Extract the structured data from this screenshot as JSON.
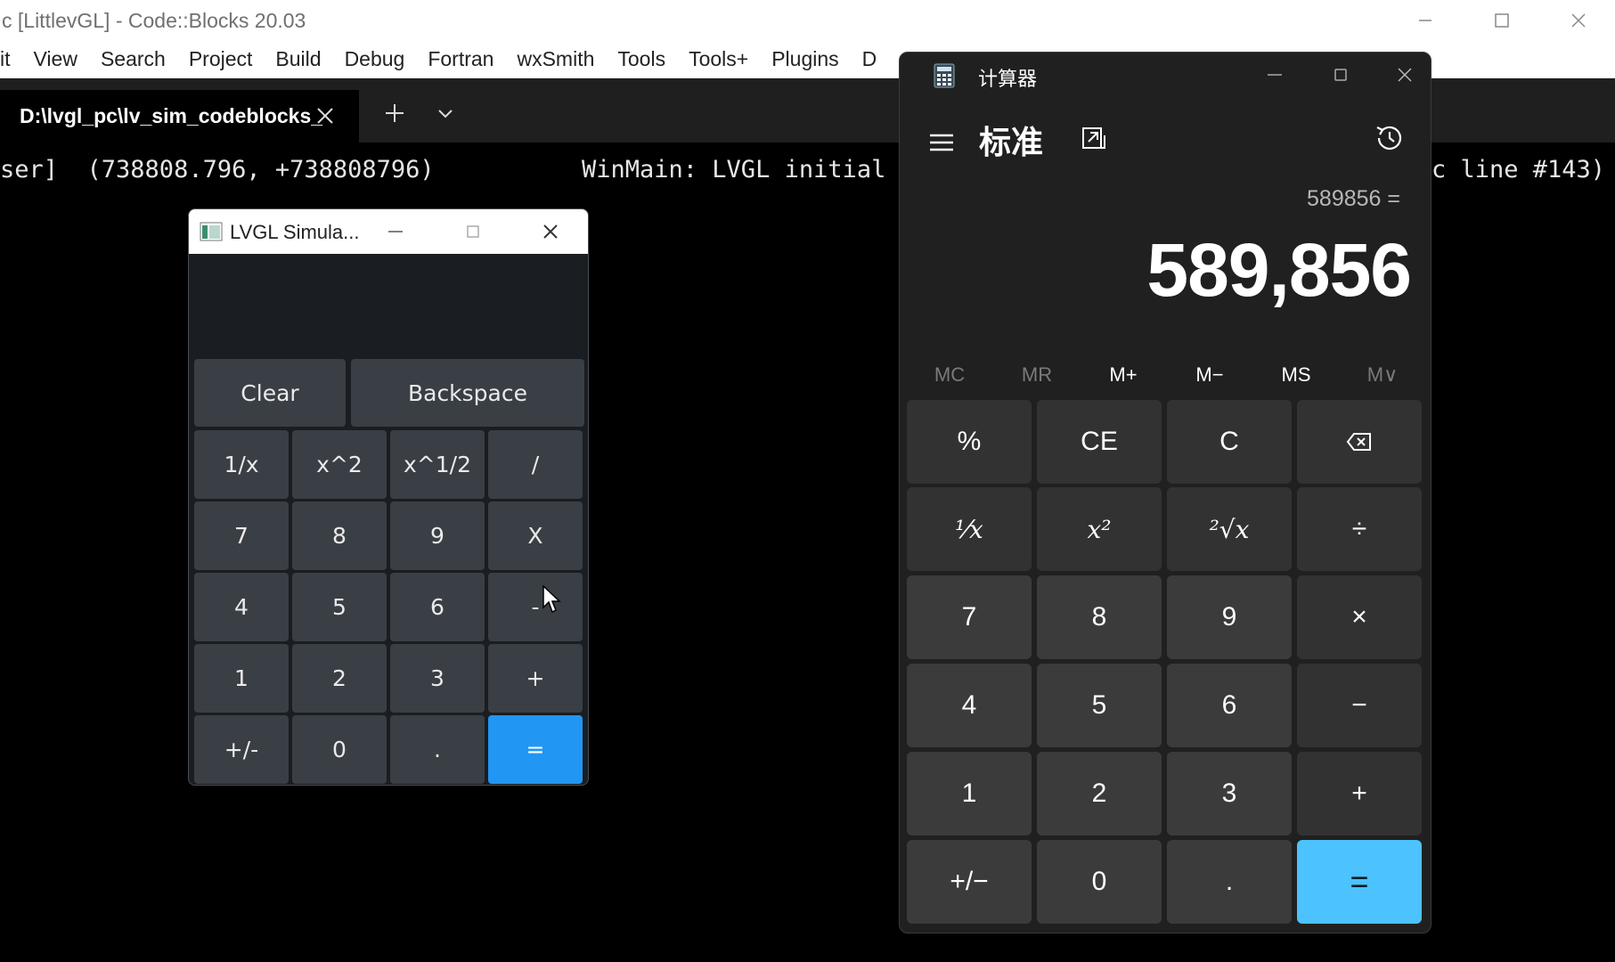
{
  "codeblocks": {
    "window_title": "c [LittlevGL] - Code::Blocks 20.03",
    "menu": [
      "it",
      "View",
      "Search",
      "Project",
      "Build",
      "Debug",
      "Fortran",
      "wxSmith",
      "Tools",
      "Tools+",
      "Plugins",
      "D"
    ],
    "tab_label": "D:\\lvgl_pc\\lv_sim_codeblocks_",
    "log": {
      "left": "ser]  (738808.796, +738808796)",
      "middle": "WinMain: LVGL initial",
      "right": "c line #143)"
    }
  },
  "lvgl_window": {
    "title": "LVGL Simula...",
    "keys": {
      "clear": "Clear",
      "backspace": "Backspace",
      "reciprocal": "1/x",
      "square": "x^2",
      "sqrt": "x^1/2",
      "divide": "/",
      "k7": "7",
      "k8": "8",
      "k9": "9",
      "multiply": "X",
      "k4": "4",
      "k5": "5",
      "k6": "6",
      "minus": "-",
      "k1": "1",
      "k2": "2",
      "k3": "3",
      "plus": "+",
      "negate": "+/-",
      "k0": "0",
      "dot": ".",
      "equals": "="
    },
    "accent_color": "#2196f3"
  },
  "windows_calculator": {
    "title": "计算器",
    "mode": "标准",
    "expression": "589856 =",
    "result": "589,856",
    "memory": [
      "MC",
      "MR",
      "M+",
      "M−",
      "MS",
      "M∨"
    ],
    "keys": {
      "percent": "%",
      "ce": "CE",
      "c": "C",
      "reciprocal": "⅟x",
      "square": "x²",
      "sqrt": "²√x",
      "divide": "÷",
      "k7": "7",
      "k8": "8",
      "k9": "9",
      "multiply": "×",
      "k4": "4",
      "k5": "5",
      "k6": "6",
      "minus": "−",
      "k1": "1",
      "k2": "2",
      "k3": "3",
      "plus": "+",
      "negate": "+/−",
      "k0": "0",
      "dot": ".",
      "equals": "="
    },
    "accent_color": "#4cc2ff"
  }
}
